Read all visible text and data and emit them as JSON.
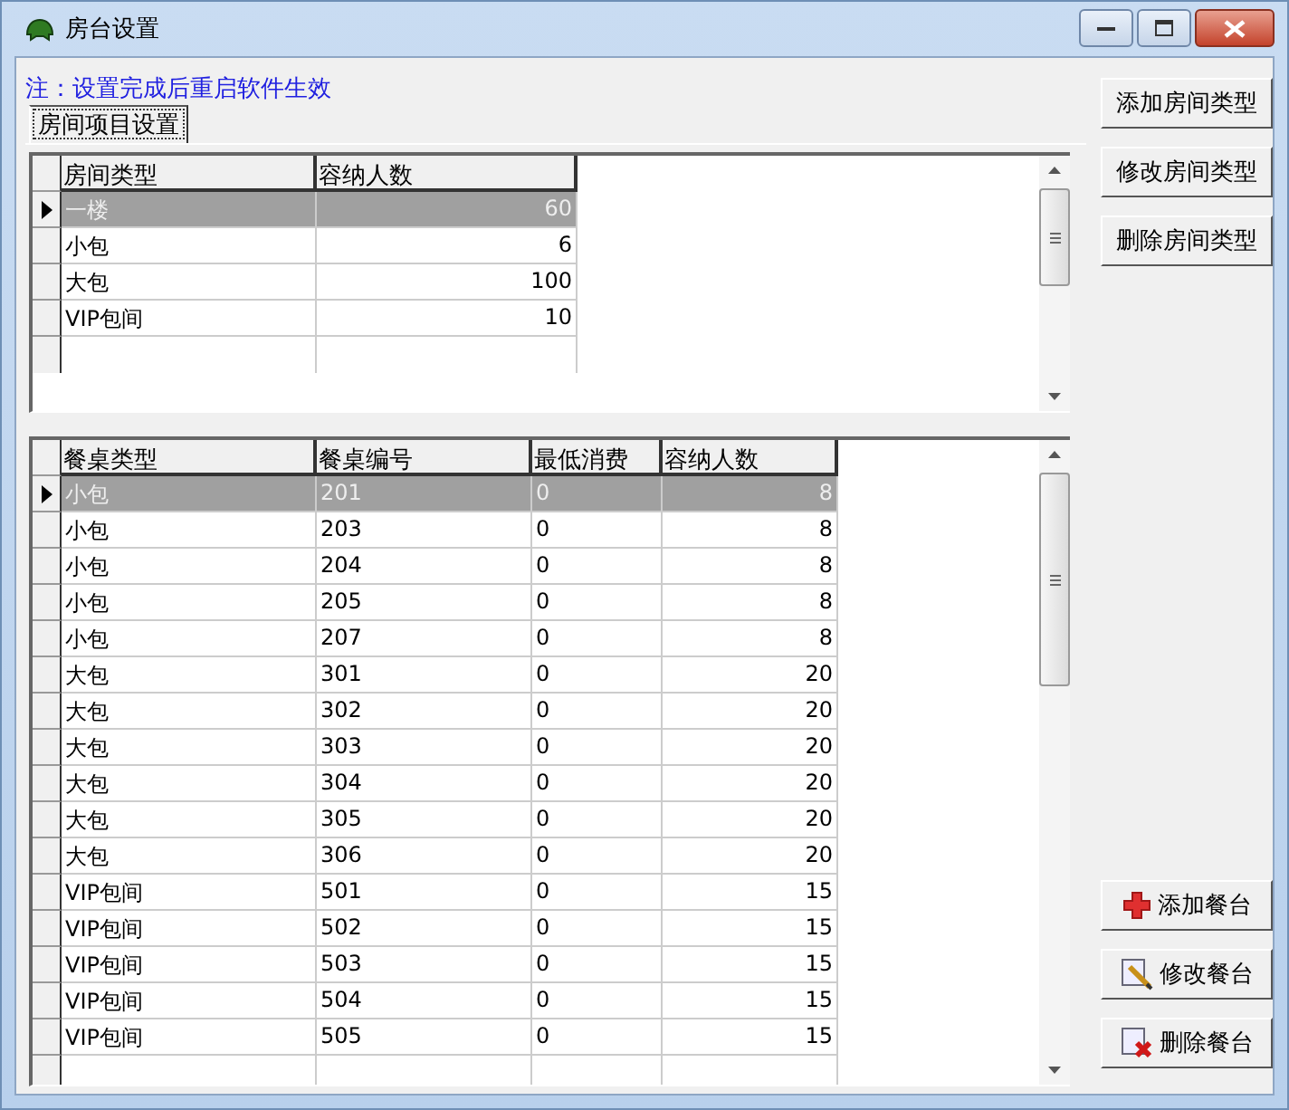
{
  "window": {
    "title": "房台设置"
  },
  "note": "注：设置完成后重启软件生效",
  "tabs": [
    {
      "label": "房间项目设置",
      "selected": true
    }
  ],
  "room_types": {
    "columns": [
      "房间类型",
      "容纳人数"
    ],
    "rows": [
      {
        "cells": [
          "一楼",
          "60"
        ],
        "selected": true
      },
      {
        "cells": [
          "小包",
          "6"
        ],
        "selected": false
      },
      {
        "cells": [
          "大包",
          "100"
        ],
        "selected": false
      },
      {
        "cells": [
          "VIP包间",
          "10"
        ],
        "selected": false
      }
    ]
  },
  "room_buttons": [
    {
      "label": "添加房间类型"
    },
    {
      "label": "修改房间类型"
    },
    {
      "label": "删除房间类型"
    }
  ],
  "tables": {
    "columns": [
      "餐桌类型",
      "餐桌编号",
      "最低消费",
      "容纳人数"
    ],
    "rows": [
      {
        "cells": [
          "小包",
          "201",
          "0",
          "8"
        ],
        "selected": true
      },
      {
        "cells": [
          "小包",
          "203",
          "0",
          "8"
        ],
        "selected": false
      },
      {
        "cells": [
          "小包",
          "204",
          "0",
          "8"
        ],
        "selected": false
      },
      {
        "cells": [
          "小包",
          "205",
          "0",
          "8"
        ],
        "selected": false
      },
      {
        "cells": [
          "小包",
          "207",
          "0",
          "8"
        ],
        "selected": false
      },
      {
        "cells": [
          "大包",
          "301",
          "0",
          "20"
        ],
        "selected": false
      },
      {
        "cells": [
          "大包",
          "302",
          "0",
          "20"
        ],
        "selected": false
      },
      {
        "cells": [
          "大包",
          "303",
          "0",
          "20"
        ],
        "selected": false
      },
      {
        "cells": [
          "大包",
          "304",
          "0",
          "20"
        ],
        "selected": false
      },
      {
        "cells": [
          "大包",
          "305",
          "0",
          "20"
        ],
        "selected": false
      },
      {
        "cells": [
          "大包",
          "306",
          "0",
          "20"
        ],
        "selected": false
      },
      {
        "cells": [
          "VIP包间",
          "501",
          "0",
          "15"
        ],
        "selected": false
      },
      {
        "cells": [
          "VIP包间",
          "502",
          "0",
          "15"
        ],
        "selected": false
      },
      {
        "cells": [
          "VIP包间",
          "503",
          "0",
          "15"
        ],
        "selected": false
      },
      {
        "cells": [
          "VIP包间",
          "504",
          "0",
          "15"
        ],
        "selected": false
      },
      {
        "cells": [
          "VIP包间",
          "505",
          "0",
          "15"
        ],
        "selected": false
      }
    ]
  },
  "table_buttons": [
    {
      "label": "添加餐台",
      "kind": "add"
    },
    {
      "label": "修改餐台",
      "kind": "edit"
    },
    {
      "label": "删除餐台",
      "kind": "delete"
    }
  ]
}
